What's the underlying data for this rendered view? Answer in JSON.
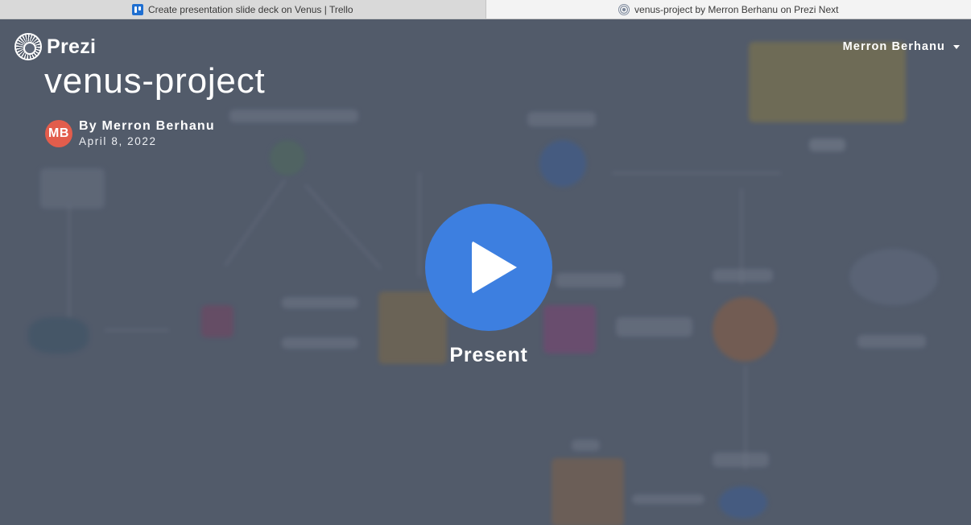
{
  "browser": {
    "tabs": [
      {
        "title": "Create presentation slide deck on Venus | Trello",
        "icon": "trello-icon",
        "active": false
      },
      {
        "title": "venus-project by Merron Berhanu on Prezi Next",
        "icon": "prezi-icon",
        "active": true
      }
    ]
  },
  "header": {
    "logo_text": "Prezi",
    "user_name": "Merron Berhanu"
  },
  "presentation": {
    "title": "venus-project",
    "author_initials": "MB",
    "author_line": "By Merron Berhanu",
    "date": "April 8, 2022"
  },
  "player": {
    "present_label": "Present"
  },
  "colors": {
    "play_button": "#3d7fe0",
    "avatar": "#e25d4c",
    "overlay": "#5d6677"
  }
}
